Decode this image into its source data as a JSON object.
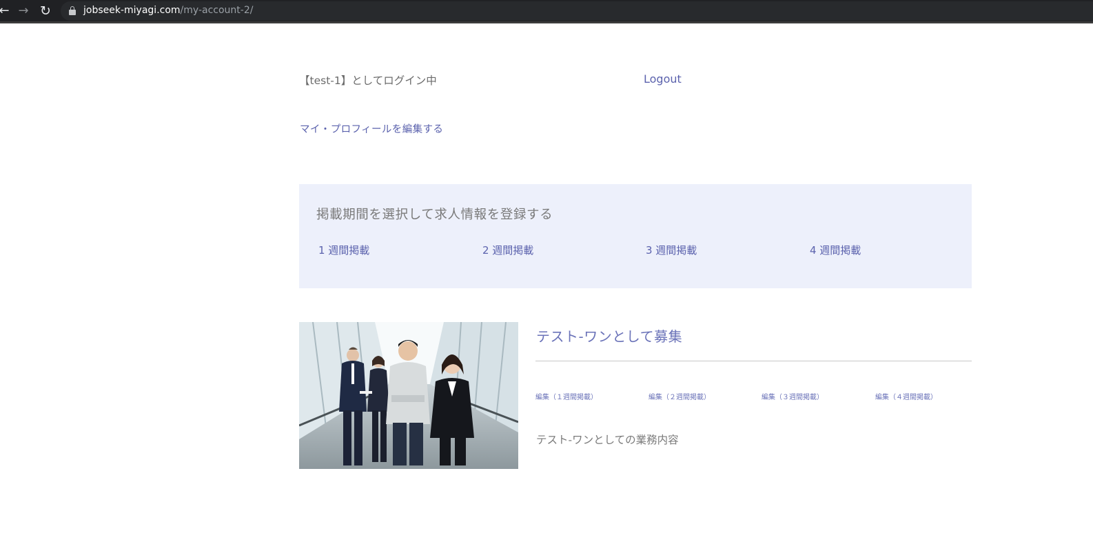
{
  "browser": {
    "url_host": "jobseek-miyagi.com",
    "url_path": "/my-account-2/",
    "back_icon": "arrow-left-icon",
    "forward_icon": "arrow-right-icon",
    "reload_icon": "reload-icon",
    "lock_icon": "lock-icon"
  },
  "header": {
    "login_status": "【test-1】としてログイン中",
    "logout_label": "Logout"
  },
  "profile": {
    "edit_label": "マイ・プロフィールを編集する"
  },
  "register": {
    "title": "掲載期間を選択して求人情報を登録する",
    "periods": [
      "1 週間掲載",
      "2 週間掲載",
      "3 週間掲載",
      "4 週間掲載"
    ]
  },
  "job": {
    "title": "テスト-ワンとして募集",
    "edit_links": [
      "編集（１週間掲載）",
      "編集（２週間掲載）",
      "編集（３週間掲載）",
      "編集（４週間掲載）"
    ],
    "description": "テスト-ワンとしての業務内容"
  },
  "colors": {
    "link": "#5b62ad",
    "register_background": "#edf0fb",
    "chrome_background": "#202124"
  }
}
